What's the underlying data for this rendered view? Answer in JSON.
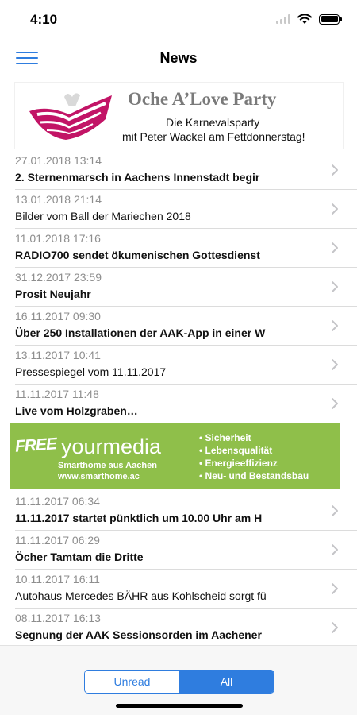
{
  "status_bar": {
    "time": "4:10"
  },
  "nav": {
    "title": "News",
    "menu_icon": "hamburger-menu-icon"
  },
  "banner_top": {
    "title": "Oche A’Love Party",
    "line1": "Die Karnevalsparty",
    "line2": "mit Peter Wackel am Fettdonnerstag!"
  },
  "news_top": [
    {
      "date": "27.01.2018 13:14",
      "title": "2. Sternenmarsch in Aachens Innenstadt begir",
      "bold": true
    },
    {
      "date": "13.01.2018 21:14",
      "title": "Bilder vom Ball der Mariechen 2018",
      "bold": false
    },
    {
      "date": "11.01.2018 17:16",
      "title": "RADIO700 sendet ökumenischen Gottesdienst",
      "bold": true
    },
    {
      "date": "31.12.2017 23:59",
      "title": "Prosit Neujahr",
      "bold": true
    },
    {
      "date": "16.11.2017 09:30",
      "title": "Über 250 Installationen der AAK-App in einer W",
      "bold": true
    },
    {
      "date": "13.11.2017 10:41",
      "title": "Pressespiegel vom 11.11.2017",
      "bold": false
    },
    {
      "date": "11.11.2017 11:48",
      "title": "Live vom Holzgraben…",
      "bold": true
    }
  ],
  "banner_ad": {
    "free": "FREE",
    "your": "your",
    "media": "media",
    "line1": "Smarthome aus Aachen",
    "line2": "www.smarthome.ac",
    "bullets": [
      "Sicherheit",
      "Lebensqualität",
      "Energieeffizienz",
      "Neu- und Bestandsbau"
    ]
  },
  "news_bottom": [
    {
      "date": "11.11.2017 06:34",
      "title": "11.11.2017 startet pünktlich um 10.00 Uhr am H",
      "bold": true
    },
    {
      "date": "11.11.2017 06:29",
      "title": "Öcher Tamtam die Dritte",
      "bold": true
    },
    {
      "date": "10.11.2017 16:11",
      "title": "Autohaus Mercedes BÄHR aus Kohlscheid sorgt fü",
      "bold": false
    },
    {
      "date": "08.11.2017 16:13",
      "title": "Segnung der AAK Sessionsorden im Aachener",
      "bold": true
    }
  ],
  "filter": {
    "unread_label": "Unread",
    "all_label": "All",
    "selected": "All"
  },
  "colors": {
    "accent": "#2f7ddf",
    "ad_green": "#8fbf4a",
    "logo_magenta": "#c21466"
  }
}
